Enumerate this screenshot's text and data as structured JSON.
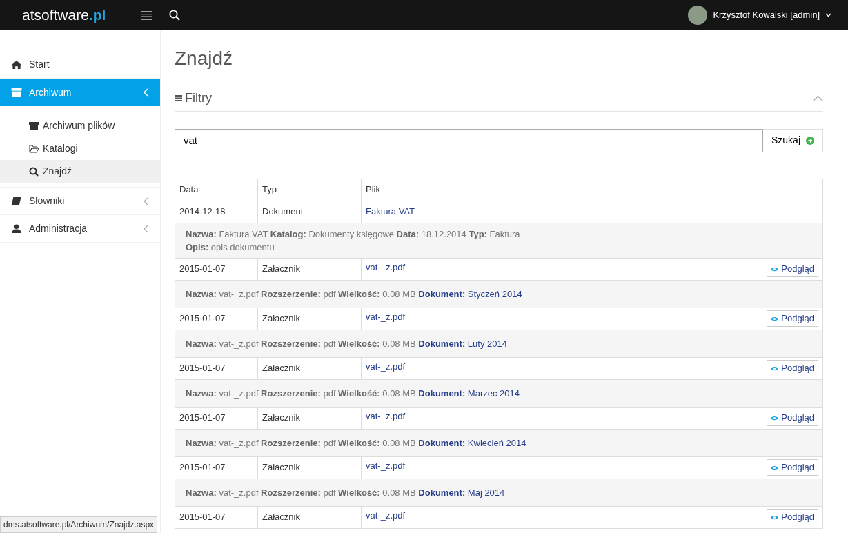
{
  "topbar": {
    "brand": "atsoftware",
    "brand_suffix": ".pl",
    "user": "Krzysztof Kowalski [admin]"
  },
  "sidebar": {
    "items": [
      {
        "label": "Start",
        "selected": false,
        "expandable": false
      },
      {
        "label": "Archiwum",
        "selected": true,
        "expandable": true,
        "expanded": true,
        "children": [
          {
            "label": "Archiwum plików",
            "selected": false
          },
          {
            "label": "Katalogi",
            "selected": false
          },
          {
            "label": "Znajdź",
            "selected": true
          }
        ]
      },
      {
        "label": "Słowniki",
        "selected": false,
        "expandable": true,
        "expanded": false
      },
      {
        "label": "Administracja",
        "selected": false,
        "expandable": true,
        "expanded": false
      }
    ]
  },
  "page": {
    "title": "Znajdź",
    "filters": {
      "title": "Filtry",
      "expanded": true
    },
    "search": {
      "value": "vat",
      "button": "Szukaj"
    },
    "table": {
      "columns": [
        "Data",
        "Typ",
        "Plik"
      ],
      "rows": [
        {
          "date": "2014-12-18",
          "type": "Dokument",
          "file": "Faktura VAT",
          "details": [
            [
              {
                "label": "Nazwa:",
                "value": "Faktura VAT",
                "link": false
              },
              {
                "label": "Katalog:",
                "value": "Dokumenty księgowe",
                "link": false
              },
              {
                "label": "Data:",
                "value": "18.12.2014",
                "link": false
              },
              {
                "label": "Typ:",
                "value": "Faktura",
                "link": false
              }
            ],
            [
              {
                "label": "Opis:",
                "value": "opis dokumentu",
                "link": false
              }
            ]
          ]
        },
        {
          "date": "2015-01-07",
          "type": "Załacznik",
          "file": "vat-_z.pdf",
          "preview": "Podgląd",
          "details": [
            [
              {
                "label": "Nazwa:",
                "value": "vat-_z.pdf",
                "link": false
              },
              {
                "label": "Rozszerzenie:",
                "value": "pdf",
                "link": false
              },
              {
                "label": "Wielkość:",
                "value": "0.08 MB",
                "link": false
              },
              {
                "label": "Dokument:",
                "value": "Styczeń 2014",
                "link": true
              }
            ]
          ]
        },
        {
          "date": "2015-01-07",
          "type": "Załacznik",
          "file": "vat-_z.pdf",
          "preview": "Podgląd",
          "details": [
            [
              {
                "label": "Nazwa:",
                "value": "vat-_z.pdf",
                "link": false
              },
              {
                "label": "Rozszerzenie:",
                "value": "pdf",
                "link": false
              },
              {
                "label": "Wielkość:",
                "value": "0.08 MB",
                "link": false
              },
              {
                "label": "Dokument:",
                "value": "Luty 2014",
                "link": true
              }
            ]
          ]
        },
        {
          "date": "2015-01-07",
          "type": "Załacznik",
          "file": "vat-_z.pdf",
          "preview": "Podgląd",
          "details": [
            [
              {
                "label": "Nazwa:",
                "value": "vat-_z.pdf",
                "link": false
              },
              {
                "label": "Rozszerzenie:",
                "value": "pdf",
                "link": false
              },
              {
                "label": "Wielkość:",
                "value": "0.08 MB",
                "link": false
              },
              {
                "label": "Dokument:",
                "value": "Marzec 2014",
                "link": true
              }
            ]
          ]
        },
        {
          "date": "2015-01-07",
          "type": "Załacznik",
          "file": "vat-_z.pdf",
          "preview": "Podgląd",
          "details": [
            [
              {
                "label": "Nazwa:",
                "value": "vat-_z.pdf",
                "link": false
              },
              {
                "label": "Rozszerzenie:",
                "value": "pdf",
                "link": false
              },
              {
                "label": "Wielkość:",
                "value": "0.08 MB",
                "link": false
              },
              {
                "label": "Dokument:",
                "value": "Kwiecień 2014",
                "link": true
              }
            ]
          ]
        },
        {
          "date": "2015-01-07",
          "type": "Załacznik",
          "file": "vat-_z.pdf",
          "preview": "Podgląd",
          "details": [
            [
              {
                "label": "Nazwa:",
                "value": "vat-_z.pdf",
                "link": false
              },
              {
                "label": "Rozszerzenie:",
                "value": "pdf",
                "link": false
              },
              {
                "label": "Wielkość:",
                "value": "0.08 MB",
                "link": false
              },
              {
                "label": "Dokument:",
                "value": "Maj 2014",
                "link": true
              }
            ]
          ]
        },
        {
          "date": "2015-01-07",
          "type": "Załacznik",
          "file": "vat-_z.pdf",
          "preview": "Podgląd"
        }
      ]
    }
  },
  "status_bar": "dms.atsoftware.pl/Archiwum/Znajdz.aspx"
}
